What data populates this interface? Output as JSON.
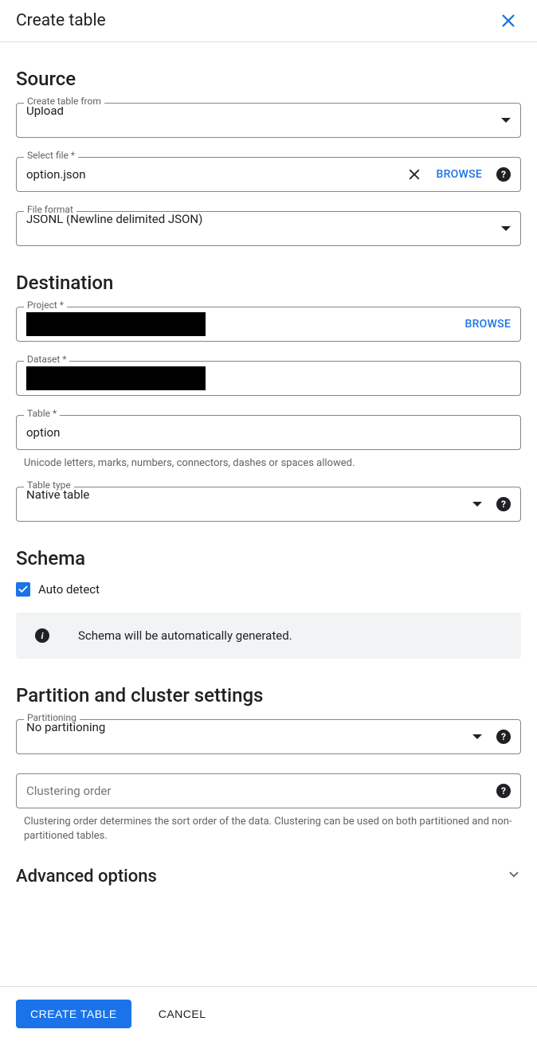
{
  "header": {
    "title": "Create table"
  },
  "source": {
    "heading": "Source",
    "create_from_label": "Create table from",
    "create_from_value": "Upload",
    "select_file_label": "Select file *",
    "select_file_value": "option.json",
    "browse_label": "BROWSE",
    "file_format_label": "File format",
    "file_format_value": "JSONL (Newline delimited JSON)"
  },
  "destination": {
    "heading": "Destination",
    "project_label": "Project *",
    "project_value": "",
    "browse_label": "BROWSE",
    "dataset_label": "Dataset *",
    "dataset_value": "",
    "table_label": "Table *",
    "table_value": "option",
    "table_helper": "Unicode letters, marks, numbers, connectors, dashes or spaces allowed.",
    "table_type_label": "Table type",
    "table_type_value": "Native table"
  },
  "schema": {
    "heading": "Schema",
    "auto_detect_label": "Auto detect",
    "auto_detect_checked": true,
    "banner_text": "Schema will be automatically generated."
  },
  "partition": {
    "heading": "Partition and cluster settings",
    "partitioning_label": "Partitioning",
    "partitioning_value": "No partitioning",
    "clustering_placeholder": "Clustering order",
    "clustering_helper": "Clustering order determines the sort order of the data. Clustering can be used on both partitioned and non-partitioned tables."
  },
  "advanced": {
    "heading": "Advanced options"
  },
  "footer": {
    "create_label": "CREATE TABLE",
    "cancel_label": "CANCEL"
  }
}
